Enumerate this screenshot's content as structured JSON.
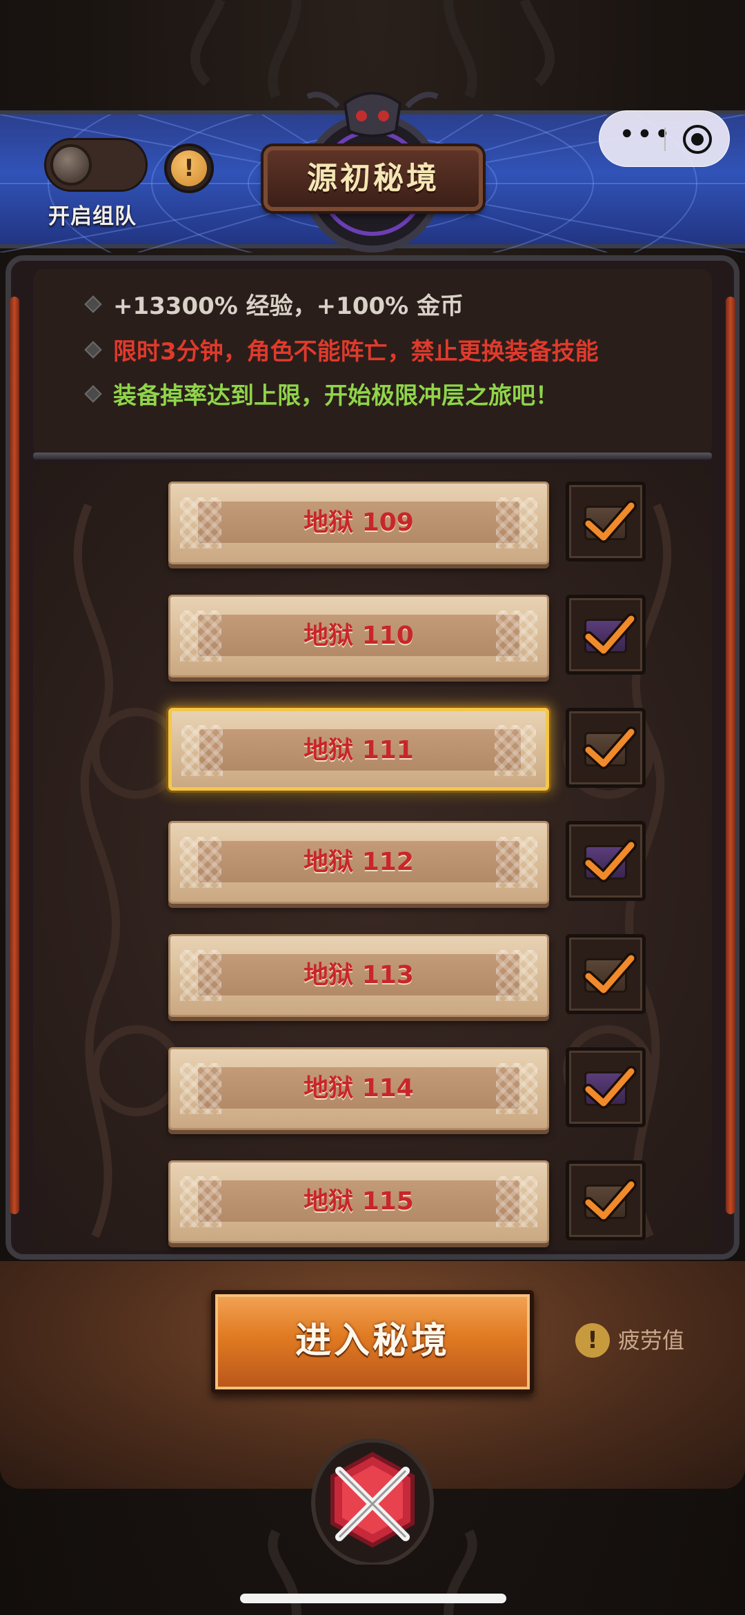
{
  "header": {
    "title": "源初秘境",
    "team_toggle": {
      "label": "开启组队",
      "on": false
    },
    "info_icon": "exclamation-icon",
    "capsule": {
      "more_icon": "more-dots-icon",
      "close_icon": "target-icon"
    }
  },
  "info": {
    "lines": [
      {
        "text": "+13300% 经验，+100% 金币",
        "color": "#d9d2c8"
      },
      {
        "text": "限时3分钟，角色不能阵亡，禁止更换装备技能",
        "color": "#e03a2c"
      },
      {
        "text": "装备掉率达到上限，开始极限冲层之旅吧！",
        "color": "#8fd54a"
      }
    ]
  },
  "levels": [
    {
      "label": "地狱 109",
      "selected": false,
      "chest": "brown"
    },
    {
      "label": "地狱 110",
      "selected": false,
      "chest": "purple"
    },
    {
      "label": "地狱 111",
      "selected": true,
      "chest": "brown"
    },
    {
      "label": "地狱 112",
      "selected": false,
      "chest": "purple"
    },
    {
      "label": "地狱 113",
      "selected": false,
      "chest": "brown"
    },
    {
      "label": "地狱 114",
      "selected": false,
      "chest": "purple"
    },
    {
      "label": "地狱 115",
      "selected": false,
      "chest": "brown"
    }
  ],
  "footer": {
    "enter_label": "进入秘境",
    "fatigue_label": "疲劳值",
    "fatigue_icon": "exclamation-icon",
    "emblem_icon": "crossed-swords-icon"
  },
  "colors": {
    "accent_orange": "#e07a22",
    "level_text": "#c8262a",
    "selected_border": "#f3c84a",
    "banner_blue": "#3153b7"
  }
}
